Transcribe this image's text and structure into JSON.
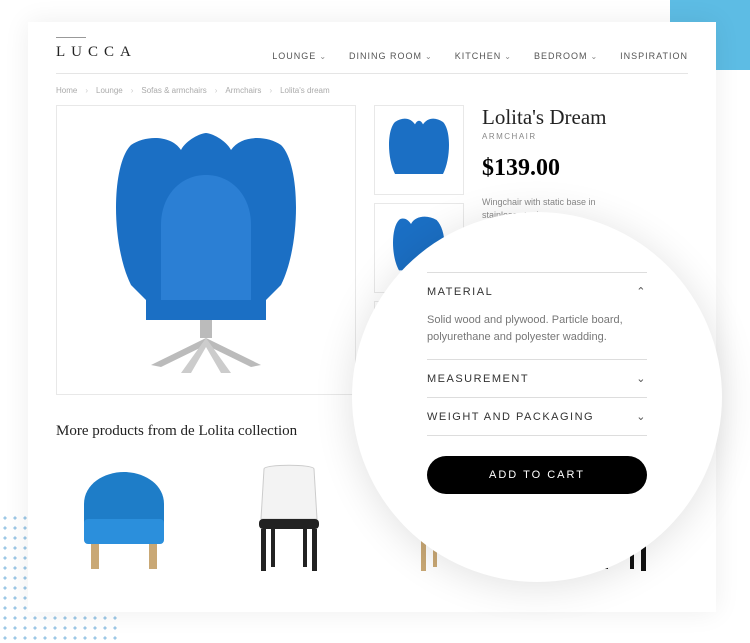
{
  "brand": "LUCCA",
  "nav": {
    "lounge": "LOUNGE",
    "dining": "DINING ROOM",
    "kitchen": "KITCHEN",
    "bedroom": "BEDROOM",
    "inspiration": "INSPIRATION"
  },
  "breadcrumb": {
    "home": "Home",
    "lounge": "Lounge",
    "sofas": "Sofas & armchairs",
    "armchairs": "Armchairs",
    "current": "Lolita's dream"
  },
  "product": {
    "title": "Lolita's Dream",
    "subtitle": "ARMCHAIR",
    "price": "$139.00",
    "desc": "Wingchair with static base in stainless steel.",
    "swatches": [
      {
        "color": "#1B6FC4",
        "selected": true
      },
      {
        "color": "#F0A03C",
        "selected": false
      }
    ]
  },
  "accordion": {
    "material": {
      "label": "MATERIAL",
      "body": "Solid wood and plywood. Particle board, polyurethane and polyester wadding."
    },
    "measurement": {
      "label": "MEASUREMENT"
    },
    "weight": {
      "label": "WEIGHT AND PACKAGING"
    }
  },
  "cart": "ADD TO CART",
  "more_title": "More products from de Lolita collection"
}
